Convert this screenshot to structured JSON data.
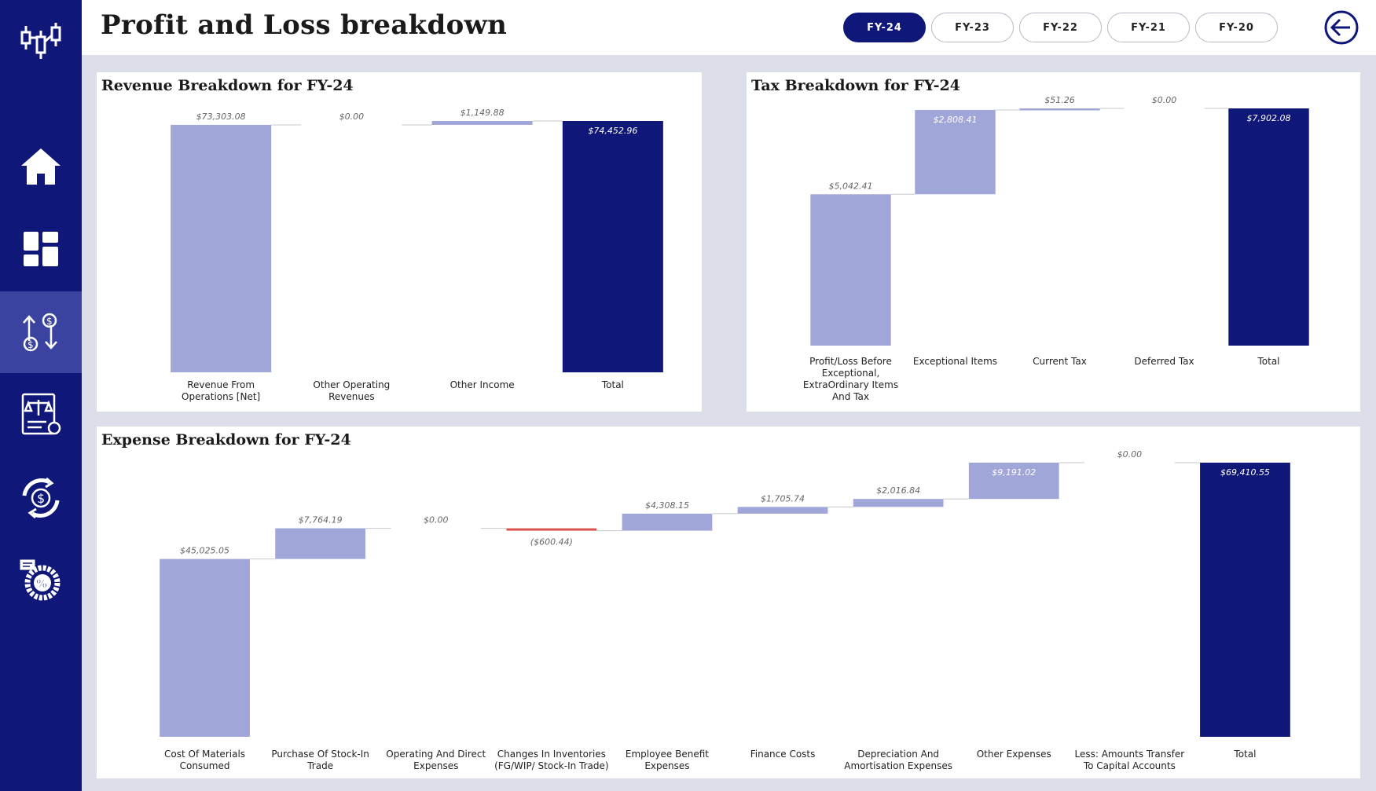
{
  "header": {
    "title": "Profit and Loss breakdown"
  },
  "fy_buttons": [
    {
      "label": "FY-24",
      "active": true
    },
    {
      "label": "FY-23",
      "active": false
    },
    {
      "label": "FY-22",
      "active": false
    },
    {
      "label": "FY-21",
      "active": false
    },
    {
      "label": "FY-20",
      "active": false
    }
  ],
  "sidebar": {
    "items": [
      {
        "icon": "candlestick-logo-icon",
        "active": false
      },
      {
        "icon": "home-icon",
        "active": false
      },
      {
        "icon": "dashboard-icon",
        "active": false
      },
      {
        "icon": "cash-flow-icon",
        "active": true
      },
      {
        "icon": "balance-sheet-icon",
        "active": false
      },
      {
        "icon": "currency-cycle-icon",
        "active": false
      },
      {
        "icon": "percentage-ratio-icon",
        "active": false
      }
    ]
  },
  "colors": {
    "sidebar": "#0f1878",
    "increase": "#a1a6d8",
    "decrease": "#d9534f",
    "total": "#0f1878",
    "background": "#dcdee9"
  },
  "chart_data": [
    {
      "type": "bar",
      "subtype": "waterfall",
      "title": "Revenue Breakdown for FY-24",
      "categories": [
        [
          "Revenue From",
          "Operations [Net]"
        ],
        [
          "Other Operating",
          "Revenues"
        ],
        [
          "Other Income"
        ],
        [
          "Total"
        ]
      ],
      "values": [
        73303.08,
        0.0,
        1149.88,
        74452.96
      ],
      "labels": [
        "$73,303.08",
        "$0.00",
        "$1,149.88",
        "$74,452.96"
      ],
      "is_total": [
        false,
        false,
        false,
        true
      ],
      "ylim": [
        0,
        74452.96
      ]
    },
    {
      "type": "bar",
      "subtype": "waterfall",
      "title": "Tax Breakdown for FY-24",
      "categories": [
        [
          "Profit/Loss Before",
          "Exceptional,",
          "ExtraOrdinary Items",
          "And Tax"
        ],
        [
          "Exceptional Items"
        ],
        [
          "Current Tax"
        ],
        [
          "Deferred Tax"
        ],
        [
          "Total"
        ]
      ],
      "values": [
        5042.41,
        2808.41,
        51.26,
        0.0,
        7902.08
      ],
      "labels": [
        "$5,042.41",
        "$2,808.41",
        "$51.26",
        "$0.00",
        "$7,902.08"
      ],
      "is_total": [
        false,
        false,
        false,
        false,
        true
      ],
      "ylim": [
        0,
        7902.08
      ]
    },
    {
      "type": "bar",
      "subtype": "waterfall",
      "title": "Expense Breakdown for FY-24",
      "categories": [
        [
          "Cost Of Materials",
          "Consumed"
        ],
        [
          "Purchase Of Stock-In",
          "Trade"
        ],
        [
          "Operating And Direct",
          "Expenses"
        ],
        [
          "Changes In Inventories",
          "(FG/WIP/ Stock-In Trade)"
        ],
        [
          "Employee Benefit",
          "Expenses"
        ],
        [
          "Finance Costs"
        ],
        [
          "Depreciation And",
          "Amortisation Expenses"
        ],
        [
          "Other Expenses"
        ],
        [
          "Less: Amounts Transfer",
          "To Capital Accounts"
        ],
        [
          "Total"
        ]
      ],
      "values": [
        45025.05,
        7764.19,
        0.0,
        -600.44,
        4308.15,
        1705.74,
        2016.84,
        9191.02,
        0.0,
        69410.55
      ],
      "labels": [
        "$45,025.05",
        "$7,764.19",
        "$0.00",
        "($600.44)",
        "$4,308.15",
        "$1,705.74",
        "$2,016.84",
        "$9,191.02",
        "$0.00",
        "$69,410.55"
      ],
      "is_total": [
        false,
        false,
        false,
        false,
        false,
        false,
        false,
        false,
        false,
        true
      ],
      "ylim": [
        0,
        69410.55
      ]
    }
  ]
}
